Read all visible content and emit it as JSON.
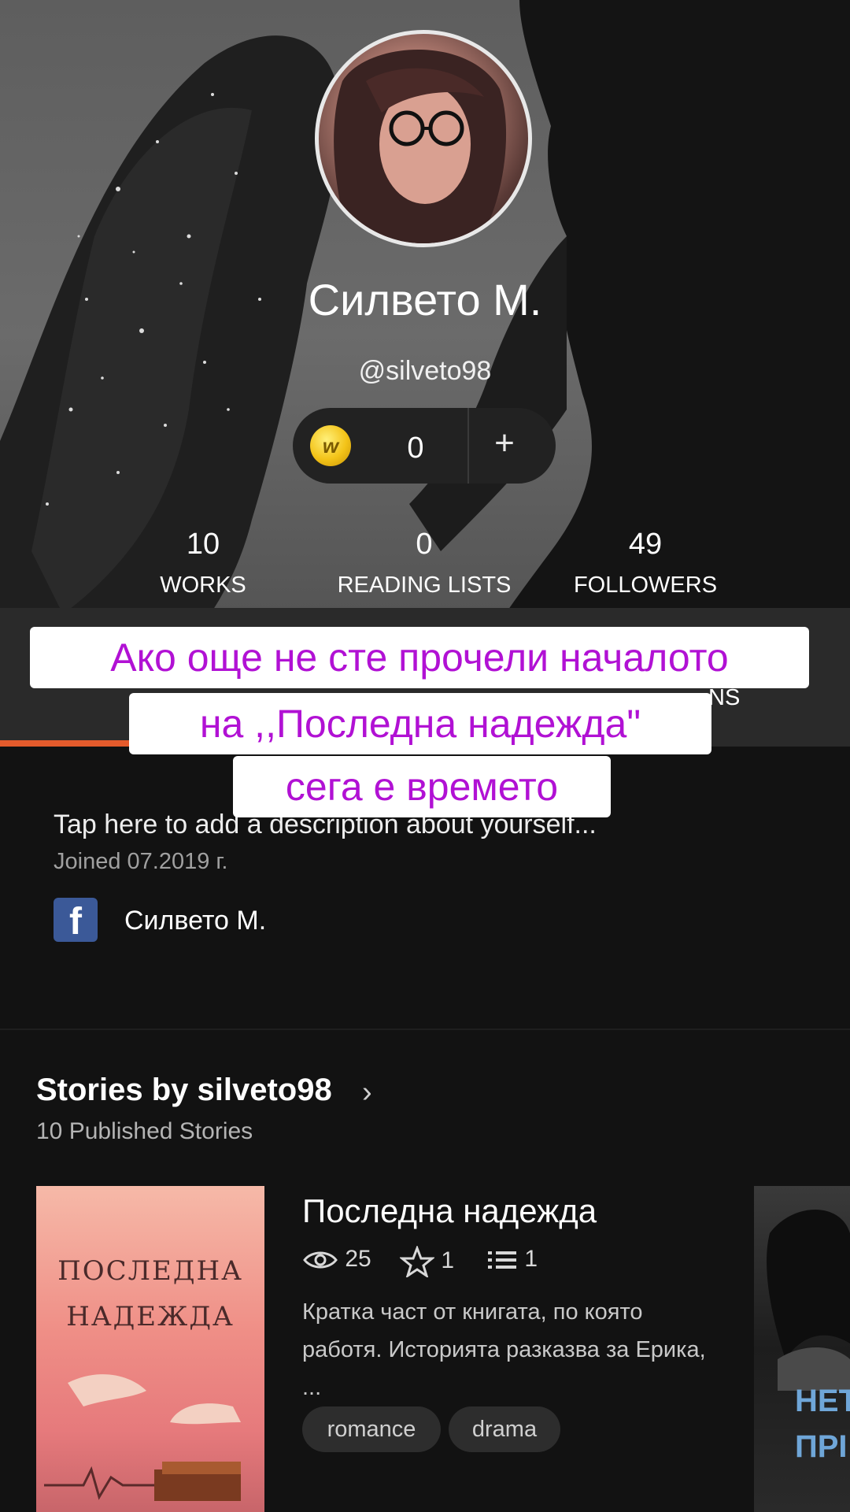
{
  "profile": {
    "display_name": "Силвето М.",
    "username": "@silveto98",
    "coins": {
      "icon": "wattpad-coin-icon",
      "count": "0",
      "add_label": "+"
    }
  },
  "stats": [
    {
      "value": "10",
      "label": "WORKS"
    },
    {
      "value": "0",
      "label": "READING LISTS"
    },
    {
      "value": "49",
      "label": "FOLLOWERS"
    }
  ],
  "tabs": {
    "partial_label": "NS"
  },
  "overlay_caption": {
    "line1": "Ако още не сте прочели началото",
    "line2": "на ,,Последна надежда\"",
    "line3": "сега е времето",
    "text_color": "#b111d4",
    "bg_color": "#ffffff"
  },
  "about": {
    "description": "Tap here to add a description about yourself...",
    "joined": "Joined 07.2019 г.",
    "facebook": {
      "icon": "facebook-icon",
      "name": "Силвето М."
    }
  },
  "stories": {
    "title": "Stories by silveto98",
    "chevron": "›",
    "count": "10 Published Stories",
    "items": [
      {
        "title": "Последна надежда",
        "cover_title": "ПОСЛЕДНА НАДЕЖДА",
        "views": "25",
        "votes": "1",
        "parts": "1",
        "description": "Кратка част от книгата, по която работя. Историята разказва за Ерика, ...",
        "tags": [
          "romance",
          "drama"
        ]
      },
      {
        "cover_title": "НЕТ ПРІ"
      }
    ]
  },
  "accent_color": "#e55b2c"
}
